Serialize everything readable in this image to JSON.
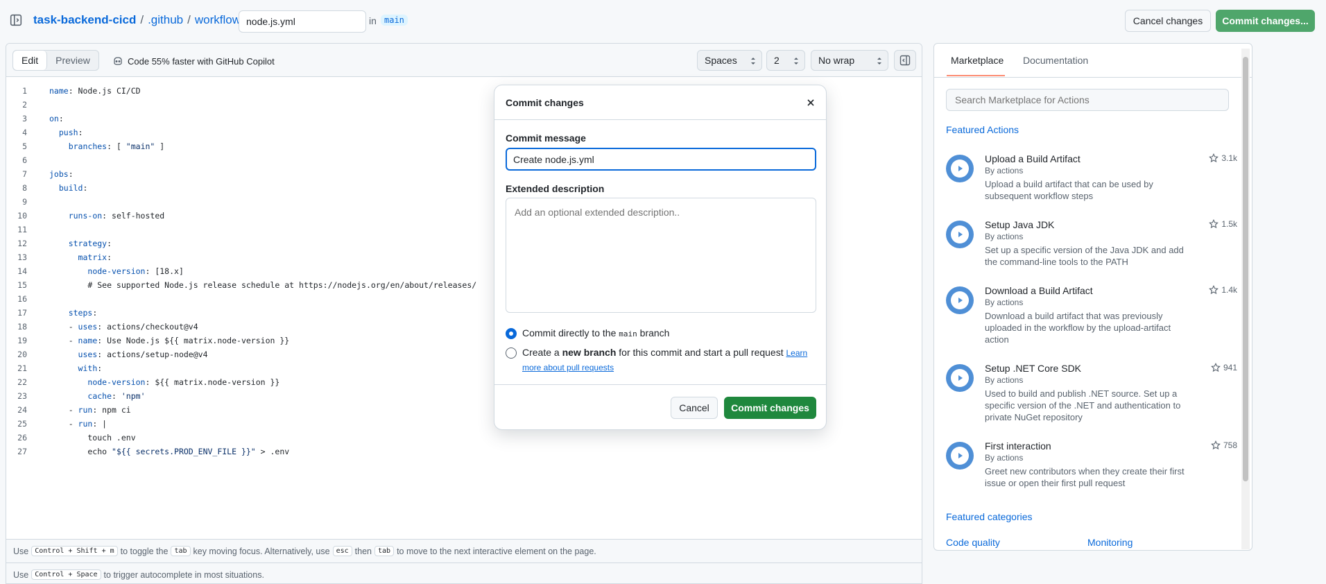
{
  "header": {
    "repo": "task-backend-cicd",
    "path1": ".github",
    "path2": "workflows",
    "filename": "node.js.yml",
    "in_label": "in",
    "branch": "main",
    "cancel_label": "Cancel changes",
    "commit_label": "Commit changes..."
  },
  "editor": {
    "tab_edit": "Edit",
    "tab_preview": "Preview",
    "copilot_text": "Code 55% faster with GitHub Copilot",
    "indent_mode": "Spaces",
    "indent_size": "2",
    "wrap_mode": "No wrap",
    "lines": [
      {
        "n": "1",
        "parts": [
          [
            "k",
            "name"
          ],
          [
            "c",
            ": Node.js CI/CD"
          ]
        ]
      },
      {
        "n": "2",
        "parts": []
      },
      {
        "n": "3",
        "parts": [
          [
            "k",
            "on"
          ],
          [
            "c",
            ":"
          ]
        ]
      },
      {
        "n": "4",
        "parts": [
          [
            "c",
            "  "
          ],
          [
            "k",
            "push"
          ],
          [
            "c",
            ":"
          ]
        ]
      },
      {
        "n": "5",
        "parts": [
          [
            "c",
            "    "
          ],
          [
            "k",
            "branches"
          ],
          [
            "c",
            ": [ "
          ],
          [
            "s",
            "\"main\""
          ],
          [
            "c",
            " ]"
          ]
        ]
      },
      {
        "n": "6",
        "parts": []
      },
      {
        "n": "7",
        "parts": [
          [
            "k",
            "jobs"
          ],
          [
            "c",
            ":"
          ]
        ]
      },
      {
        "n": "8",
        "parts": [
          [
            "c",
            "  "
          ],
          [
            "k",
            "build"
          ],
          [
            "c",
            ":"
          ]
        ]
      },
      {
        "n": "9",
        "parts": []
      },
      {
        "n": "10",
        "parts": [
          [
            "c",
            "    "
          ],
          [
            "k",
            "runs-on"
          ],
          [
            "c",
            ": self-hosted"
          ]
        ]
      },
      {
        "n": "11",
        "parts": []
      },
      {
        "n": "12",
        "parts": [
          [
            "c",
            "    "
          ],
          [
            "k",
            "strategy"
          ],
          [
            "c",
            ":"
          ]
        ]
      },
      {
        "n": "13",
        "parts": [
          [
            "c",
            "      "
          ],
          [
            "k",
            "matrix"
          ],
          [
            "c",
            ":"
          ]
        ]
      },
      {
        "n": "14",
        "parts": [
          [
            "c",
            "        "
          ],
          [
            "k",
            "node-version"
          ],
          [
            "c",
            ": [18.x]"
          ]
        ]
      },
      {
        "n": "15",
        "parts": [
          [
            "c",
            "        # See supported Node.js release schedule at https://nodejs.org/en/about/releases/"
          ]
        ]
      },
      {
        "n": "16",
        "parts": []
      },
      {
        "n": "17",
        "parts": [
          [
            "c",
            "    "
          ],
          [
            "k",
            "steps"
          ],
          [
            "c",
            ":"
          ]
        ]
      },
      {
        "n": "18",
        "parts": [
          [
            "c",
            "    - "
          ],
          [
            "k",
            "uses"
          ],
          [
            "c",
            ": actions/checkout@v4"
          ]
        ]
      },
      {
        "n": "19",
        "parts": [
          [
            "c",
            "    - "
          ],
          [
            "k",
            "name"
          ],
          [
            "c",
            ": Use Node.js ${{ matrix.node-version }}"
          ]
        ]
      },
      {
        "n": "20",
        "parts": [
          [
            "c",
            "      "
          ],
          [
            "k",
            "uses"
          ],
          [
            "c",
            ": actions/setup-node@v4"
          ]
        ]
      },
      {
        "n": "21",
        "parts": [
          [
            "c",
            "      "
          ],
          [
            "k",
            "with"
          ],
          [
            "c",
            ":"
          ]
        ]
      },
      {
        "n": "22",
        "parts": [
          [
            "c",
            "        "
          ],
          [
            "k",
            "node-version"
          ],
          [
            "c",
            ": ${{ matrix.node-version }}"
          ]
        ]
      },
      {
        "n": "23",
        "parts": [
          [
            "c",
            "        "
          ],
          [
            "k",
            "cache"
          ],
          [
            "c",
            ": "
          ],
          [
            "s",
            "'npm'"
          ]
        ]
      },
      {
        "n": "24",
        "parts": [
          [
            "c",
            "    - "
          ],
          [
            "k",
            "run"
          ],
          [
            "c",
            ": npm ci"
          ]
        ]
      },
      {
        "n": "25",
        "parts": [
          [
            "c",
            "    - "
          ],
          [
            "k",
            "run"
          ],
          [
            "c",
            ": |"
          ]
        ]
      },
      {
        "n": "26",
        "parts": [
          [
            "c",
            "        touch .env"
          ]
        ]
      },
      {
        "n": "27",
        "parts": [
          [
            "c",
            "        echo "
          ],
          [
            "s",
            "\"${{ secrets.PROD_ENV_FILE }}\""
          ],
          [
            "c",
            " > .env"
          ]
        ]
      }
    ],
    "hint1": {
      "a": "Use",
      "k1": "Control + Shift + m",
      "b": "to toggle the",
      "k2": "tab",
      "c": "key moving focus. Alternatively, use",
      "k3": "esc",
      "d": "then",
      "k4": "tab",
      "e": "to move to the next interactive element on the page."
    },
    "hint2": {
      "a": "Use",
      "k1": "Control + Space",
      "b": "to trigger autocomplete in most situations."
    }
  },
  "marketplace": {
    "tab_marketplace": "Marketplace",
    "tab_documentation": "Documentation",
    "search_placeholder": "Search Marketplace for Actions",
    "featured_heading": "Featured Actions",
    "actions": [
      {
        "title": "Upload a Build Artifact",
        "by": "By actions",
        "desc": "Upload a build artifact that can be used by subsequent workflow steps",
        "stars": "3.1k"
      },
      {
        "title": "Setup Java JDK",
        "by": "By actions",
        "desc": "Set up a specific version of the Java JDK and add the command-line tools to the PATH",
        "stars": "1.5k"
      },
      {
        "title": "Download a Build Artifact",
        "by": "By actions",
        "desc": "Download a build artifact that was previously uploaded in the workflow by the upload-artifact action",
        "stars": "1.4k"
      },
      {
        "title": "Setup .NET Core SDK",
        "by": "By actions",
        "desc": "Used to build and publish .NET source. Set up a specific version of the .NET and authentication to private NuGet repository",
        "stars": "941"
      },
      {
        "title": "First interaction",
        "by": "By actions",
        "desc": "Greet new contributors when they create their first issue or open their first pull request",
        "stars": "758"
      }
    ],
    "categories_heading": "Featured categories",
    "categories": [
      "Code quality",
      "Monitoring"
    ]
  },
  "modal": {
    "title": "Commit changes",
    "message_label": "Commit message",
    "message_value": "Create node.js.yml",
    "desc_label": "Extended description",
    "desc_placeholder": "Add an optional extended description..",
    "opt1_a": "Commit directly to the",
    "opt1_branch": "main",
    "opt1_b": "branch",
    "opt2_a": "Create a",
    "opt2_bold": "new branch",
    "opt2_b": "for this commit and start a pull request",
    "opt2_link": "Learn more about pull requests",
    "cancel_label": "Cancel",
    "commit_label": "Commit changes"
  }
}
